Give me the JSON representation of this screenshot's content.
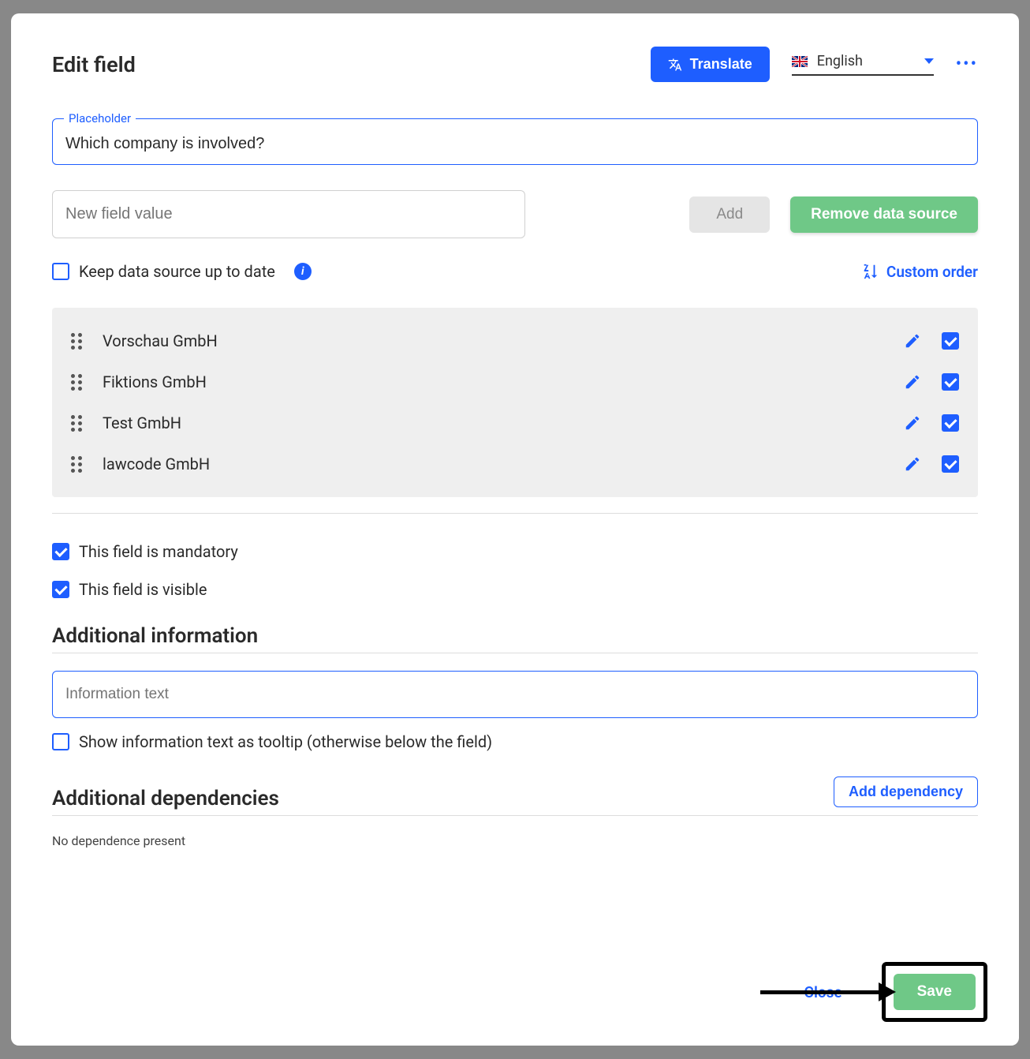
{
  "header": {
    "title": "Edit field",
    "translate_label": "Translate",
    "language": "English"
  },
  "placeholder": {
    "label": "Placeholder",
    "value": "Which company is involved?"
  },
  "new_value_placeholder": "New field value",
  "add_label": "Add",
  "remove_ds_label": "Remove data source",
  "keep_ds_label": "Keep data source up to date",
  "custom_order_label": "Custom order",
  "items": [
    {
      "label": "Vorschau GmbH"
    },
    {
      "label": "Fiktions GmbH"
    },
    {
      "label": "Test GmbH"
    },
    {
      "label": "lawcode GmbH"
    }
  ],
  "mandatory_label": "This field is mandatory",
  "visible_label": "This field is visible",
  "additional_info_title": "Additional information",
  "info_placeholder": "Information text",
  "tooltip_label": "Show information text as tooltip (otherwise below the field)",
  "deps_title": "Additional dependencies",
  "add_dep_label": "Add dependency",
  "no_dep_text": "No dependence present",
  "footer": {
    "close": "Close",
    "save": "Save"
  }
}
